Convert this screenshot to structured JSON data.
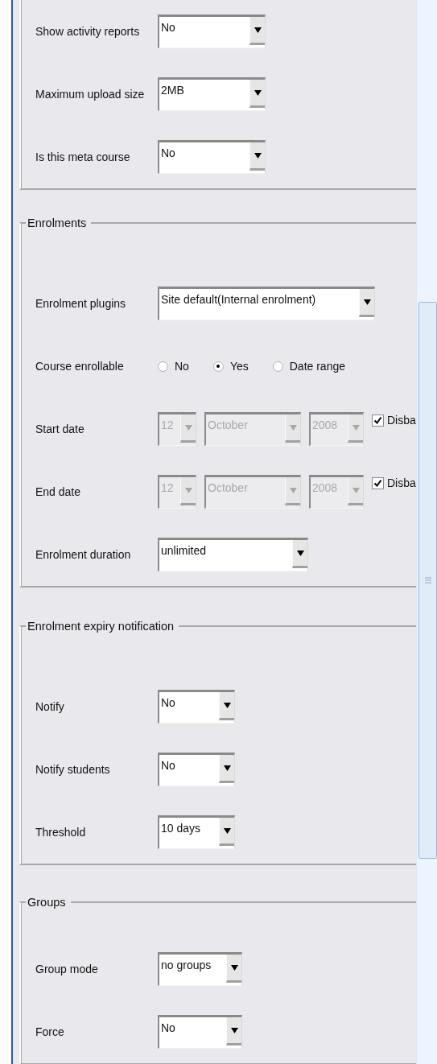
{
  "sections": [
    {
      "fields": [
        {
          "kind": "select",
          "label": "Show activity reports",
          "value": "No"
        },
        {
          "kind": "select",
          "label": "Maximum upload size",
          "value": "2MB"
        },
        {
          "kind": "select",
          "label": "Is this meta course",
          "value": "No"
        }
      ]
    },
    {
      "legend": "Enrolments",
      "fields": [
        {
          "kind": "select",
          "label": "Enrolment plugins",
          "value": "Site default(Internal enrolment)"
        },
        {
          "kind": "radio",
          "label": "Course enrollable",
          "options": [
            {
              "label": "No",
              "selected": false
            },
            {
              "label": "Yes",
              "selected": true
            },
            {
              "label": "Date range",
              "selected": false
            }
          ]
        },
        {
          "kind": "date",
          "label": "Start date",
          "disabled": true,
          "parts": [
            "12",
            "October",
            "2008"
          ],
          "checkbox": {
            "label": "Disba",
            "checked": true
          }
        },
        {
          "kind": "date",
          "label": "End date",
          "disabled": true,
          "parts": [
            "12",
            "October",
            "2008"
          ],
          "checkbox": {
            "label": "Disba",
            "checked": true
          }
        },
        {
          "kind": "select",
          "label": "Enrolment duration",
          "value": "unlimited"
        }
      ]
    },
    {
      "legend": "Enrolment expiry notification",
      "fields": [
        {
          "kind": "select",
          "label": "Notify",
          "value": "No"
        },
        {
          "kind": "select",
          "label": "Notify students",
          "value": "No"
        },
        {
          "kind": "select",
          "label": "Threshold",
          "value": "10 days"
        }
      ]
    },
    {
      "legend": "Groups",
      "fields": [
        {
          "kind": "select",
          "label": "Group mode",
          "value": "no groups"
        },
        {
          "kind": "select",
          "label": "Force",
          "value": "No"
        }
      ]
    }
  ]
}
